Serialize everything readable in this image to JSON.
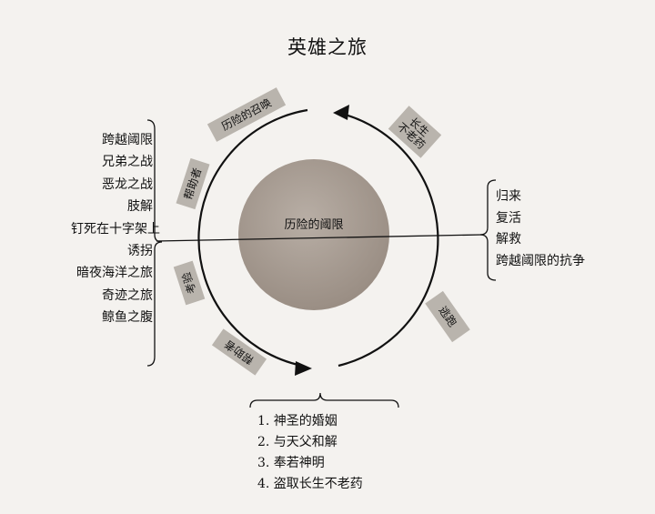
{
  "title": "英雄之旅",
  "center_label": "历险的阈限",
  "arc_tags": {
    "call": "历险的召唤",
    "elixir_line1": "长生",
    "elixir_line2": "不老药",
    "helper_top": "帮助者",
    "test": "考验",
    "helper_bottom": "帮助者",
    "flight": "逃跑"
  },
  "left_list": [
    "跨越阈限",
    "兄弟之战",
    "恶龙之战",
    "肢解",
    "钉死在十字架上",
    "诱拐",
    "暗夜海洋之旅",
    "奇迹之旅",
    "鲸鱼之腹"
  ],
  "right_list": [
    "归来",
    "复活",
    "解救",
    "跨越阈限的抗争"
  ],
  "bottom_list": [
    "1. 神圣的婚姻",
    "2. 与天父和解",
    "3. 奉若神明",
    "4. 盗取长生不老药"
  ],
  "colors": {
    "disk": "#a59a90",
    "tag": "#b9b4ad",
    "line": "#111111"
  }
}
